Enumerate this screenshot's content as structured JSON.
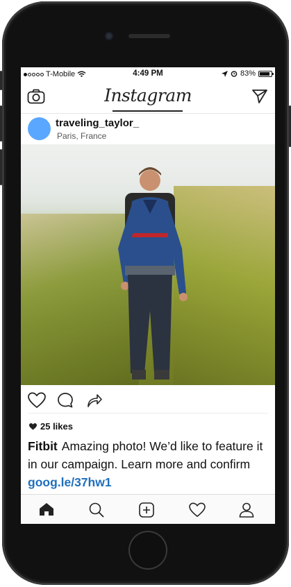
{
  "status_bar": {
    "carrier": "T-Mobile",
    "time": "4:49 PM",
    "battery": "83%"
  },
  "nav": {
    "logo": "Instagram"
  },
  "post": {
    "username": "traveling_taylor_",
    "location": "Paris, France",
    "likes": "25 likes"
  },
  "caption": {
    "author": "Fitbit",
    "text": "Amazing photo! We’d like to feature it in our campaign. Learn more and confirm",
    "link": "goog.le/37hw1"
  },
  "colors": {
    "avatar": "#5aa7ff",
    "link": "#1f6fbd"
  },
  "icons": {
    "nav_left": "camera-icon",
    "nav_right": "send-icon",
    "actions": [
      "heart-icon",
      "comment-icon",
      "share-icon"
    ],
    "tabs": [
      "home-icon",
      "search-icon",
      "add-icon",
      "activity-icon",
      "profile-icon"
    ]
  }
}
